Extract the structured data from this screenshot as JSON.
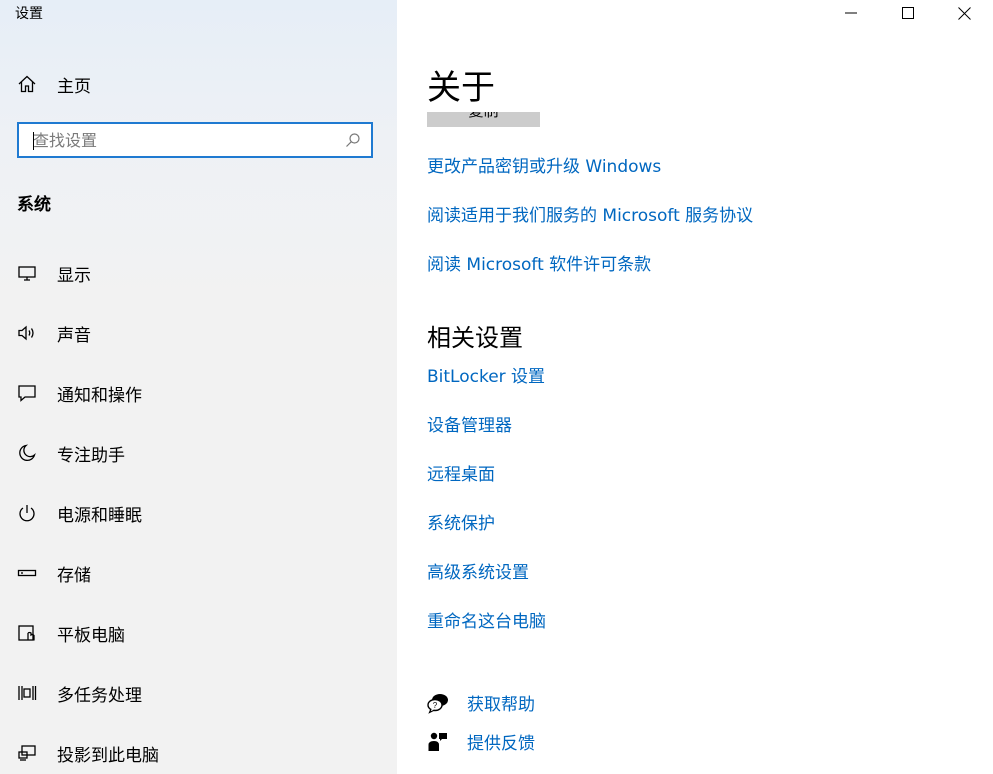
{
  "window": {
    "title": "设置",
    "controls": [
      "minimize",
      "maximize",
      "close"
    ]
  },
  "sidebar": {
    "home_label": "主页",
    "search_placeholder": "查找设置",
    "section": "系统",
    "items": [
      {
        "label": "显示",
        "icon": "display-icon"
      },
      {
        "label": "声音",
        "icon": "speaker-icon"
      },
      {
        "label": "通知和操作",
        "icon": "notification-icon"
      },
      {
        "label": "专注助手",
        "icon": "moon-icon"
      },
      {
        "label": "电源和睡眠",
        "icon": "power-icon"
      },
      {
        "label": "存储",
        "icon": "storage-icon"
      },
      {
        "label": "平板电脑",
        "icon": "tablet-icon"
      },
      {
        "label": "多任务处理",
        "icon": "multitask-icon"
      },
      {
        "label": "投影到此电脑",
        "icon": "project-icon"
      }
    ]
  },
  "main": {
    "title": "关于",
    "copy_button": "复制",
    "links": [
      "更改产品密钥或升级 Windows",
      "阅读适用于我们服务的 Microsoft 服务协议",
      "阅读 Microsoft 软件许可条款"
    ],
    "related_heading": "相关设置",
    "related_links": [
      "BitLocker 设置",
      "设备管理器",
      "远程桌面",
      "系统保护",
      "高级系统设置",
      "重命名这台电脑"
    ],
    "help": {
      "get_help": "获取帮助",
      "feedback": "提供反馈"
    }
  },
  "colors": {
    "link": "#0067c0",
    "accent": "#1f7ad1",
    "sidebar_bg": "#f2f2f2"
  }
}
